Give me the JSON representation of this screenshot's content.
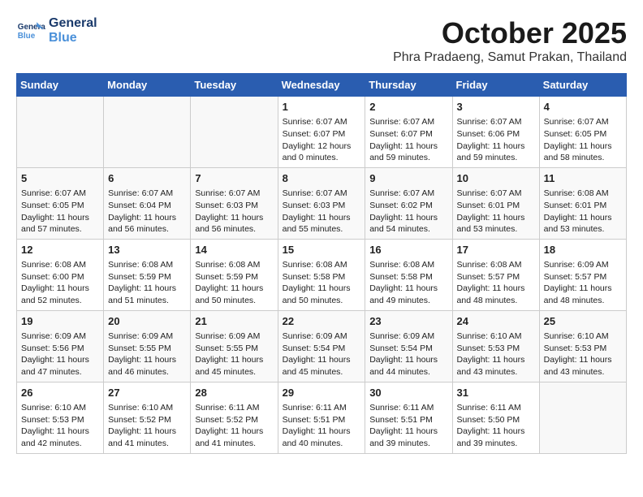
{
  "header": {
    "logo_line1": "General",
    "logo_line2": "Blue",
    "title": "October 2025",
    "subtitle": "Phra Pradaeng, Samut Prakan, Thailand"
  },
  "weekdays": [
    "Sunday",
    "Monday",
    "Tuesday",
    "Wednesday",
    "Thursday",
    "Friday",
    "Saturday"
  ],
  "weeks": [
    [
      {
        "day": "",
        "info": ""
      },
      {
        "day": "",
        "info": ""
      },
      {
        "day": "",
        "info": ""
      },
      {
        "day": "1",
        "info": "Sunrise: 6:07 AM\nSunset: 6:07 PM\nDaylight: 12 hours\nand 0 minutes."
      },
      {
        "day": "2",
        "info": "Sunrise: 6:07 AM\nSunset: 6:07 PM\nDaylight: 11 hours\nand 59 minutes."
      },
      {
        "day": "3",
        "info": "Sunrise: 6:07 AM\nSunset: 6:06 PM\nDaylight: 11 hours\nand 59 minutes."
      },
      {
        "day": "4",
        "info": "Sunrise: 6:07 AM\nSunset: 6:05 PM\nDaylight: 11 hours\nand 58 minutes."
      }
    ],
    [
      {
        "day": "5",
        "info": "Sunrise: 6:07 AM\nSunset: 6:05 PM\nDaylight: 11 hours\nand 57 minutes."
      },
      {
        "day": "6",
        "info": "Sunrise: 6:07 AM\nSunset: 6:04 PM\nDaylight: 11 hours\nand 56 minutes."
      },
      {
        "day": "7",
        "info": "Sunrise: 6:07 AM\nSunset: 6:03 PM\nDaylight: 11 hours\nand 56 minutes."
      },
      {
        "day": "8",
        "info": "Sunrise: 6:07 AM\nSunset: 6:03 PM\nDaylight: 11 hours\nand 55 minutes."
      },
      {
        "day": "9",
        "info": "Sunrise: 6:07 AM\nSunset: 6:02 PM\nDaylight: 11 hours\nand 54 minutes."
      },
      {
        "day": "10",
        "info": "Sunrise: 6:07 AM\nSunset: 6:01 PM\nDaylight: 11 hours\nand 53 minutes."
      },
      {
        "day": "11",
        "info": "Sunrise: 6:08 AM\nSunset: 6:01 PM\nDaylight: 11 hours\nand 53 minutes."
      }
    ],
    [
      {
        "day": "12",
        "info": "Sunrise: 6:08 AM\nSunset: 6:00 PM\nDaylight: 11 hours\nand 52 minutes."
      },
      {
        "day": "13",
        "info": "Sunrise: 6:08 AM\nSunset: 5:59 PM\nDaylight: 11 hours\nand 51 minutes."
      },
      {
        "day": "14",
        "info": "Sunrise: 6:08 AM\nSunset: 5:59 PM\nDaylight: 11 hours\nand 50 minutes."
      },
      {
        "day": "15",
        "info": "Sunrise: 6:08 AM\nSunset: 5:58 PM\nDaylight: 11 hours\nand 50 minutes."
      },
      {
        "day": "16",
        "info": "Sunrise: 6:08 AM\nSunset: 5:58 PM\nDaylight: 11 hours\nand 49 minutes."
      },
      {
        "day": "17",
        "info": "Sunrise: 6:08 AM\nSunset: 5:57 PM\nDaylight: 11 hours\nand 48 minutes."
      },
      {
        "day": "18",
        "info": "Sunrise: 6:09 AM\nSunset: 5:57 PM\nDaylight: 11 hours\nand 48 minutes."
      }
    ],
    [
      {
        "day": "19",
        "info": "Sunrise: 6:09 AM\nSunset: 5:56 PM\nDaylight: 11 hours\nand 47 minutes."
      },
      {
        "day": "20",
        "info": "Sunrise: 6:09 AM\nSunset: 5:55 PM\nDaylight: 11 hours\nand 46 minutes."
      },
      {
        "day": "21",
        "info": "Sunrise: 6:09 AM\nSunset: 5:55 PM\nDaylight: 11 hours\nand 45 minutes."
      },
      {
        "day": "22",
        "info": "Sunrise: 6:09 AM\nSunset: 5:54 PM\nDaylight: 11 hours\nand 45 minutes."
      },
      {
        "day": "23",
        "info": "Sunrise: 6:09 AM\nSunset: 5:54 PM\nDaylight: 11 hours\nand 44 minutes."
      },
      {
        "day": "24",
        "info": "Sunrise: 6:10 AM\nSunset: 5:53 PM\nDaylight: 11 hours\nand 43 minutes."
      },
      {
        "day": "25",
        "info": "Sunrise: 6:10 AM\nSunset: 5:53 PM\nDaylight: 11 hours\nand 43 minutes."
      }
    ],
    [
      {
        "day": "26",
        "info": "Sunrise: 6:10 AM\nSunset: 5:53 PM\nDaylight: 11 hours\nand 42 minutes."
      },
      {
        "day": "27",
        "info": "Sunrise: 6:10 AM\nSunset: 5:52 PM\nDaylight: 11 hours\nand 41 minutes."
      },
      {
        "day": "28",
        "info": "Sunrise: 6:11 AM\nSunset: 5:52 PM\nDaylight: 11 hours\nand 41 minutes."
      },
      {
        "day": "29",
        "info": "Sunrise: 6:11 AM\nSunset: 5:51 PM\nDaylight: 11 hours\nand 40 minutes."
      },
      {
        "day": "30",
        "info": "Sunrise: 6:11 AM\nSunset: 5:51 PM\nDaylight: 11 hours\nand 39 minutes."
      },
      {
        "day": "31",
        "info": "Sunrise: 6:11 AM\nSunset: 5:50 PM\nDaylight: 11 hours\nand 39 minutes."
      },
      {
        "day": "",
        "info": ""
      }
    ]
  ]
}
